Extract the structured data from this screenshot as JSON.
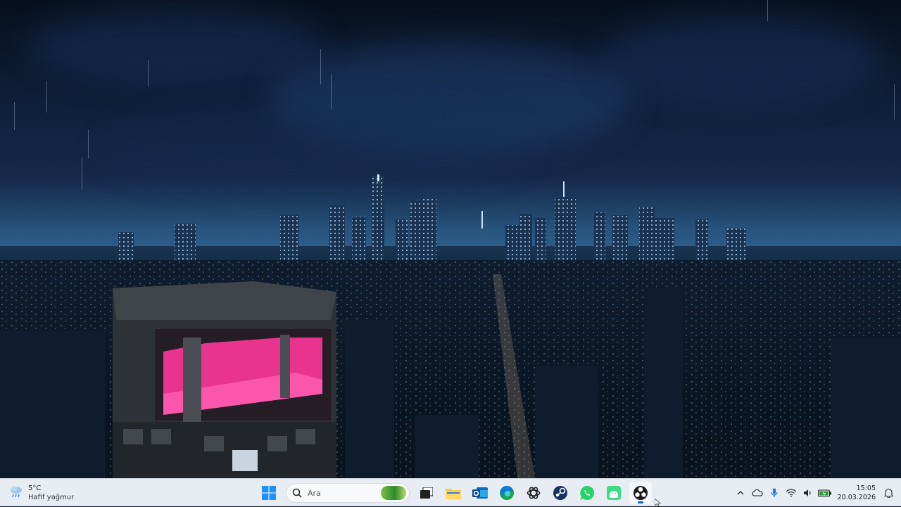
{
  "desktop": {
    "wallpaper": "rainy night city skyline",
    "colors": {
      "sky_top": "#07101f",
      "sky_mid": "#1c3a5c",
      "neon_pink": "#e8338f",
      "city_light": "#8fc7ff"
    }
  },
  "taskbar": {
    "weather": {
      "temperature": "5°C",
      "condition": "Hafif yağmur",
      "icon": "rain-cloud-icon"
    },
    "search": {
      "placeholder": "Ara"
    },
    "apps": [
      {
        "name": "start",
        "icon": "windows-icon"
      },
      {
        "name": "task-view",
        "icon": "task-view-icon"
      },
      {
        "name": "file-explorer",
        "icon": "folder-icon"
      },
      {
        "name": "outlook",
        "icon": "outlook-icon"
      },
      {
        "name": "edge",
        "icon": "edge-icon"
      },
      {
        "name": "chatgpt",
        "icon": "chatgpt-icon"
      },
      {
        "name": "steam",
        "icon": "steam-icon"
      },
      {
        "name": "whatsapp",
        "icon": "whatsapp-icon"
      },
      {
        "name": "android-app",
        "icon": "android-icon"
      },
      {
        "name": "obs-studio",
        "icon": "obs-icon",
        "active": true
      }
    ],
    "tray": {
      "icons": [
        "chevron-up-icon",
        "onedrive-icon",
        "microphone-icon",
        "wifi-icon",
        "speaker-icon",
        "battery-icon"
      ],
      "time": "15:05",
      "date": "20.03.2026",
      "notification_icon": "notification-icon"
    },
    "accent": "#0067c0"
  }
}
